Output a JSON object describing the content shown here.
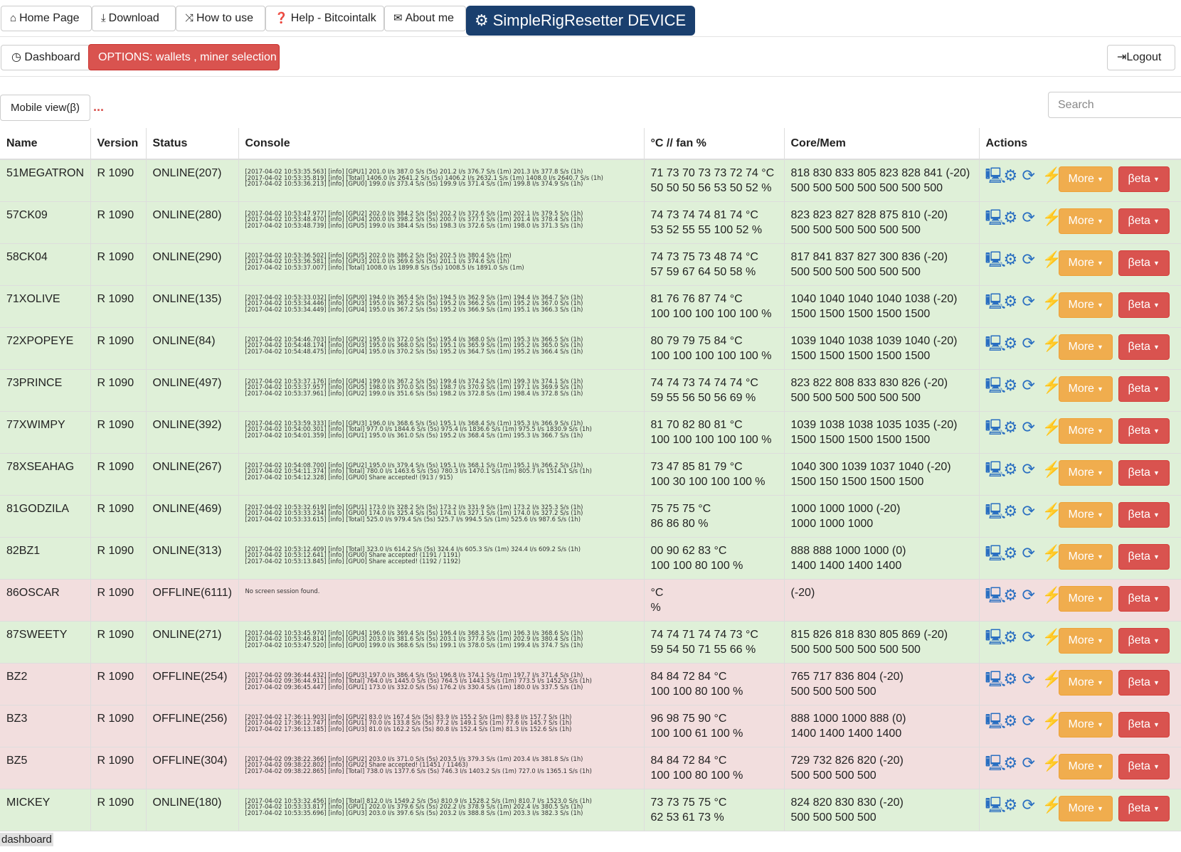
{
  "topnav": {
    "home": "Home Page",
    "download": "Download",
    "howto": "How to use",
    "help": "Help - Bitcointalk",
    "about": "About me",
    "brand": "SimpleRigResetter DEVICE"
  },
  "subnav": {
    "dashboard": "Dashboard",
    "options": "OPTIONS: wallets , miner selection",
    "logout": "Logout"
  },
  "toolbar": {
    "mobile": "Mobile view(β)",
    "dots": "...",
    "search_placeholder": "Search"
  },
  "table": {
    "headers": [
      "Name",
      "Version",
      "Status",
      "Console",
      "°C // fan %",
      "Core/Mem",
      "Actions"
    ],
    "more_label": "More",
    "beta_label": "βeta",
    "rows": [
      {
        "state": "on",
        "name": "51MEGATRON",
        "version": "R 1090",
        "status": "ONLINE(207)",
        "console": [
          "[2017-04-02 10:53:35.563] [info] [GPU1] 201.0 I/s 387.0 S/s (5s) 201.2 I/s 376.7 S/s (1m) 201.3 I/s 377.8 S/s (1h)",
          "[2017-04-02 10:53:35.819] [info] [Total] 1406.0 I/s 2641.2 S/s (5s) 1406.2 I/s 2632.1 S/s (1m) 1408.0 I/s 2640.7 S/s (1h)",
          "[2017-04-02 10:53:36.213] [info] [GPU0] 199.0 I/s 373.4 S/s (5s) 199.9 I/s 371.4 S/s (1m) 199.8 I/s 374.9 S/s (1h)"
        ],
        "temp": "71 73 70 73 73 72 74 °C",
        "fan": "50 50 50 56 53 50 52 %",
        "core": "818 830 833 805 823 828 841 (-20)",
        "mem": "500 500 500 500 500 500 500"
      },
      {
        "state": "on",
        "name": "57CK09",
        "version": "R 1090",
        "status": "ONLINE(280)",
        "console": [
          "[2017-04-02 10:53:47.977] [info] [GPU2] 202.0 I/s 384.2 S/s (5s) 202.2 I/s 372.6 S/s (1m) 202.1 I/s 379.5 S/s (1h)",
          "[2017-04-02 10:53:48.470] [info] [GPU4] 200.0 I/s 398.2 S/s (5s) 200.7 I/s 377.1 S/s (1m) 201.4 I/s 378.4 S/s (1h)",
          "[2017-04-02 10:53:48.739] [info] [GPU5] 199.0 I/s 384.4 S/s (5s) 198.3 I/s 372.6 S/s (1m) 198.0 I/s 371.3 S/s (1h)"
        ],
        "temp": "74 73 74 74 81 74 °C",
        "fan": "53 52 55 55 100 52 %",
        "core": "823 823 827 828 875 810 (-20)",
        "mem": "500 500 500 500 500 500"
      },
      {
        "state": "on",
        "name": "58CK04",
        "version": "R 1090",
        "status": "ONLINE(290)",
        "console": [
          "[2017-04-02 10:53:36.502] [info] [GPU5] 202.0 I/s 386.2 S/s (5s) 202.5 I/s 380.4 S/s (1m)",
          "[2017-04-02 10:53:36.581] [info] [GPU3] 201.0 I/s 369.6 S/s (5s) 201.1 I/s 374.6 S/s (1h)",
          "[2017-04-02 10:53:37.007] [info] [Total] 1008.0 I/s 1899.8 S/s (5s) 1008.5 I/s 1891.0 S/s (1m)"
        ],
        "temp": "74 73 75 73 48 74 °C",
        "fan": "57 59 67 64 50 58 %",
        "core": "817 841 837 827 300 836 (-20)",
        "mem": "500 500 500 500 500 500"
      },
      {
        "state": "on",
        "name": "71XOLIVE",
        "version": "R 1090",
        "status": "ONLINE(135)",
        "console": [
          "[2017-04-02 10:53:33.032] [info] [GPU0] 194.0 I/s 365.4 S/s (5s) 194.5 I/s 362.9 S/s (1m) 194.4 I/s 364.7 S/s (1h)",
          "[2017-04-02 10:53:34.446] [info] [GPU3] 195.0 I/s 367.2 S/s (5s) 195.2 I/s 366.2 S/s (1m) 195.2 I/s 367.0 S/s (1h)",
          "[2017-04-02 10:53:34.449] [info] [GPU4] 195.0 I/s 367.2 S/s (5s) 195.2 I/s 366.9 S/s (1m) 195.1 I/s 366.3 S/s (1h)"
        ],
        "temp": "81 76 76 87 74 °C",
        "fan": "100 100 100 100 100 %",
        "core": "1040 1040 1040 1040 1038 (-20)",
        "mem": "1500 1500 1500 1500 1500"
      },
      {
        "state": "on",
        "name": "72XPOPEYE",
        "version": "R 1090",
        "status": "ONLINE(84)",
        "console": [
          "[2017-04-02 10:54:46.703] [info] [GPU2] 195.0 I/s 372.0 S/s (5s) 195.4 I/s 368.0 S/s (1m) 195.3 I/s 366.5 S/s (1h)",
          "[2017-04-02 10:54:48.174] [info] [GPU3] 195.0 I/s 368.0 S/s (5s) 195.1 I/s 365.9 S/s (1m) 195.2 I/s 365.0 S/s (1h)",
          "[2017-04-02 10:54:48.475] [info] [GPU4] 195.0 I/s 370.2 S/s (5s) 195.2 I/s 364.7 S/s (1m) 195.2 I/s 366.4 S/s (1h)"
        ],
        "temp": "80 79 79 75 84 °C",
        "fan": "100 100 100 100 100 %",
        "core": "1039 1040 1038 1039 1040 (-20)",
        "mem": "1500 1500 1500 1500 1500"
      },
      {
        "state": "on",
        "name": "73PRINCE",
        "version": "R 1090",
        "status": "ONLINE(497)",
        "console": [
          "[2017-04-02 10:53:37.176] [info] [GPU4] 199.0 I/s 367.2 S/s (5s) 199.4 I/s 374.2 S/s (1m) 199.3 I/s 374.1 S/s (1h)",
          "[2017-04-02 10:53:37.957] [info] [GPU5] 198.0 I/s 370.0 S/s (5s) 198.7 I/s 370.9 S/s (1m) 197.1 I/s 369.9 S/s (1h)",
          "[2017-04-02 10:53:37.961] [info] [GPU2] 199.0 I/s 351.6 S/s (5s) 198.2 I/s 372.8 S/s (1m) 198.4 I/s 372.8 S/s (1h)"
        ],
        "temp": "74 74 73 74 74 74 °C",
        "fan": "59 55 56 50 56 69 %",
        "core": "823 822 808 833 830 826 (-20)",
        "mem": "500 500 500 500 500 500"
      },
      {
        "state": "on",
        "name": "77XWIMPY",
        "version": "R 1090",
        "status": "ONLINE(392)",
        "console": [
          "[2017-04-02 10:53:59.333] [info] [GPU3] 196.0 I/s 368.6 S/s (5s) 195.1 I/s 368.4 S/s (1m) 195.3 I/s 366.9 S/s (1h)",
          "[2017-04-02 10:54:00.301] [info] [Total] 977.0 I/s 1844.6 S/s (5s) 975.4 I/s 1836.6 S/s (1m) 975.5 I/s 1830.9 S/s (1h)",
          "[2017-04-02 10:54:01.359] [info] [GPU1] 195.0 I/s 361.0 S/s (5s) 195.2 I/s 368.4 S/s (1m) 195.3 I/s 366.7 S/s (1h)"
        ],
        "temp": "81 70 82 80 81 °C",
        "fan": "100 100 100 100 100 %",
        "core": "1039 1038 1038 1035 1035 (-20)",
        "mem": "1500 1500 1500 1500 1500"
      },
      {
        "state": "on",
        "name": "78XSEAHAG",
        "version": "R 1090",
        "status": "ONLINE(267)",
        "console": [
          "[2017-04-02 10:54:08.700] [info] [GPU2] 195.0 I/s 379.4 S/s (5s) 195.1 I/s 368.1 S/s (1m) 195.1 I/s 366.2 S/s (1h)",
          "[2017-04-02 10:54:11.374] [info] [Total] 780.0 I/s 1463.6 S/s (5s) 780.3 I/s 1470.1 S/s (1m) 805.7 I/s 1514.1 S/s (1h)",
          "[2017-04-02 10:54:12.328] [info] [GPU0] Share accepted! (913 / 915)"
        ],
        "temp": "73 47 85 81 79 °C",
        "fan": "100 30 100 100 100 %",
        "core": "1040 300 1039 1037 1040 (-20)",
        "mem": "1500 150 1500 1500 1500"
      },
      {
        "state": "on",
        "name": "81GODZILA",
        "version": "R 1090",
        "status": "ONLINE(469)",
        "console": [
          "[2017-04-02 10:53:32.619] [info] [GPU1] 173.0 I/s 328.2 S/s (5s) 173.2 I/s 331.9 S/s (1m) 173.2 I/s 325.3 S/s (1h)",
          "[2017-04-02 10:53:33.234] [info] [GPU0] 174.0 I/s 325.4 S/s (5s) 174.1 I/s 327.1 S/s (1m) 174.0 I/s 327.2 S/s (1h)",
          "[2017-04-02 10:53:33.615] [info] [Total] 525.0 I/s 979.4 S/s (5s) 525.7 I/s 994.5 S/s (1m) 525.6 I/s 987.6 S/s (1h)"
        ],
        "temp": "75 75 75 °C",
        "fan": "86 86 80 %",
        "core": "1000 1000 1000 (-20)",
        "mem": "1000 1000 1000"
      },
      {
        "state": "on",
        "name": "82BZ1",
        "version": "R 1090",
        "status": "ONLINE(313)",
        "console": [
          "[2017-04-02 10:53:12.409] [info] [Total] 323.0 I/s 614.2 S/s (5s) 324.4 I/s 605.3 S/s (1m) 324.4 I/s 609.2 S/s (1h)",
          "[2017-04-02 10:53:12.641] [info] [GPU0] Share accepted! (1191 / 1191)",
          "[2017-04-02 10:53:13.845] [info] [GPU0] Share accepted! (1192 / 1192)"
        ],
        "temp": "00 90 62 83 °C",
        "fan": "100 100 80 100 %",
        "core": "888 888 1000 1000 (0)",
        "mem": "1400 1400 1400 1400"
      },
      {
        "state": "off",
        "name": "86OSCAR",
        "version": "R 1090",
        "status": "OFFLINE(6111)",
        "console": [
          "No screen session found."
        ],
        "temp": "°C",
        "fan": "%",
        "core": "(-20)",
        "mem": ""
      },
      {
        "state": "on",
        "name": "87SWEETY",
        "version": "R 1090",
        "status": "ONLINE(271)",
        "console": [
          "[2017-04-02 10:53:45.970] [info] [GPU4] 196.0 I/s 369.4 S/s (5s) 196.4 I/s 368.3 S/s (1m) 196.3 I/s 368.6 S/s (1h)",
          "[2017-04-02 10:53:46.814] [info] [GPU3] 203.0 I/s 381.6 S/s (5s) 203.1 I/s 377.6 S/s (1m) 202.9 I/s 380.4 S/s (1h)",
          "[2017-04-02 10:53:47.520] [info] [GPU0] 199.0 I/s 368.6 S/s (5s) 199.1 I/s 378.0 S/s (1m) 199.4 I/s 374.7 S/s (1h)"
        ],
        "temp": "74 74 71 74 74 73 °C",
        "fan": "59 54 50 71 55 66 %",
        "core": "815 826 818 830 805 869 (-20)",
        "mem": "500 500 500 500 500 500"
      },
      {
        "state": "off",
        "name": "BZ2",
        "version": "R 1090",
        "status": "OFFLINE(254)",
        "console": [
          "[2017-04-02 09:36:44.432] [info] [GPU3] 197.0 I/s 386.4 S/s (5s) 196.8 I/s 374.1 S/s (1m) 197.7 I/s 371.4 S/s (1h)",
          "[2017-04-02 09:36:44.911] [info] [Total] 764.0 I/s 1445.0 S/s (5s) 764.5 I/s 1443.3 S/s (1m) 773.5 I/s 1452.3 S/s (1h)",
          "[2017-04-02 09:36:45.447] [info] [GPU1] 173.0 I/s 332.0 S/s (5s) 176.2 I/s 330.4 S/s (1m) 180.0 I/s 337.5 S/s (1h)"
        ],
        "temp": "84 84 72 84 °C",
        "fan": "100 100 80 100 %",
        "core": "765 717 836 804 (-20)",
        "mem": "500 500 500 500"
      },
      {
        "state": "off",
        "name": "BZ3",
        "version": "R 1090",
        "status": "OFFLINE(256)",
        "console": [
          "[2017-04-02 17:36:11.903] [info] [GPU2] 83.0 I/s 167.4 S/s (5s) 83.9 I/s 155.2 S/s (1m) 83.8 I/s 157.7 S/s (1h)",
          "[2017-04-02 17:36:12.747] [info] [GPU1] 70.0 I/s 133.8 S/s (5s) 77.2 I/s 149.1 S/s (1m) 77.6 I/s 145.7 S/s (1h)",
          "[2017-04-02 17:36:13.185] [info] [GPU3] 81.0 I/s 162.2 S/s (5s) 80.8 I/s 152.4 S/s (1m) 81.3 I/s 152.6 S/s (1h)"
        ],
        "temp": "96 98 75 90 °C",
        "fan": "100 100 61 100 %",
        "core": "888 1000 1000 888 (0)",
        "mem": "1400 1400 1400 1400"
      },
      {
        "state": "off",
        "name": "BZ5",
        "version": "R 1090",
        "status": "OFFLINE(304)",
        "console": [
          "[2017-04-02 09:38:22.366] [info] [GPU2] 203.0 I/s 371.0 S/s (5s) 203.5 I/s 379.3 S/s (1m) 203.4 I/s 381.8 S/s (1h)",
          "[2017-04-02 09:38:22.802] [info] [GPU2] Share accepted! (11451 / 11463)",
          "[2017-04-02 09:38:22.865] [info] [Total] 738.0 I/s 1377.6 S/s (5s) 746.3 I/s 1403.2 S/s (1m) 727.0 I/s 1365.1 S/s (1h)"
        ],
        "temp": "84 84 72 84 °C",
        "fan": "100 100 80 100 %",
        "core": "729 732 826 820 (-20)",
        "mem": "500 500 500 500"
      },
      {
        "state": "on",
        "name": "MICKEY",
        "version": "R 1090",
        "status": "ONLINE(180)",
        "console": [
          "[2017-04-02 10:53:32.456] [info] [Total] 812.0 I/s 1549.2 S/s (5s) 810.9 I/s 1528.2 S/s (1m) 810.7 I/s 1523.0 S/s (1h)",
          "[2017-04-02 10:53:33.817] [info] [GPU1] 202.0 I/s 379.6 S/s (5s) 202.2 I/s 378.9 S/s (1m) 202.4 I/s 380.5 S/s (1h)",
          "[2017-04-02 10:53:35.696] [info] [GPU3] 203.0 I/s 397.6 S/s (5s) 203.2 I/s 388.8 S/s (1m) 203.3 I/s 382.3 S/s (1h)"
        ],
        "temp": "73 73 75 75 °C",
        "fan": "62 53 61 73 %",
        "core": "824 820 830 830 (-20)",
        "mem": "500 500 500 500"
      }
    ]
  },
  "statusbar": {
    "text": "dashboard"
  },
  "colors": {
    "online_row": "#dff0d8",
    "offline_row": "#f2dede",
    "brand": "#1a3f6e",
    "danger": "#d9534f",
    "warning": "#f0ad4e",
    "icon": "#2a6fc1"
  }
}
